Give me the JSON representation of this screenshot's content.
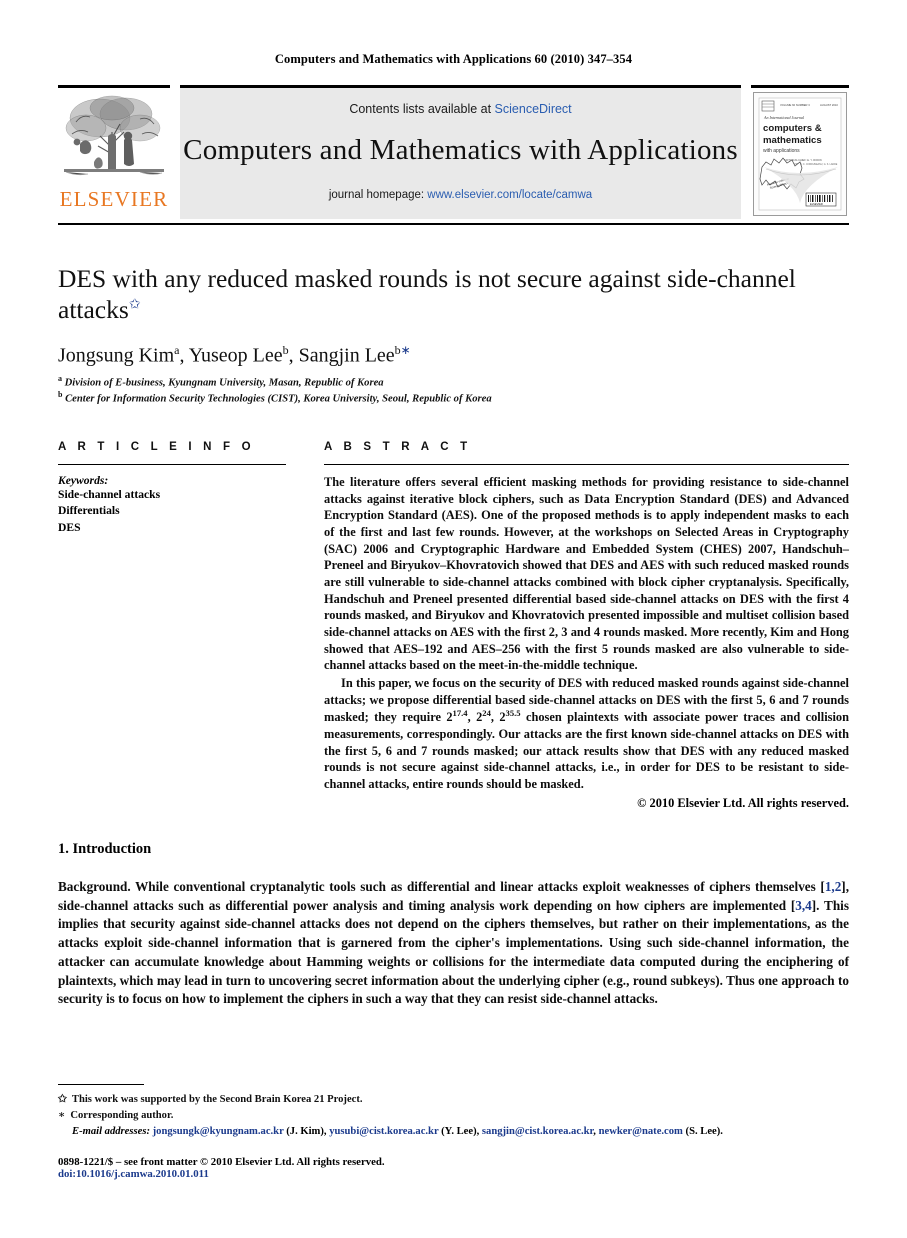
{
  "running_head": "Computers and Mathematics with Applications 60 (2010) 347–354",
  "masthead": {
    "publisher_name": "ELSEVIER",
    "contents_prefix": "Contents lists available at ",
    "contents_link": "ScienceDirect",
    "journal_title": "Computers and Mathematics with Applications",
    "homepage_prefix": "journal homepage: ",
    "homepage_url": "www.elsevier.com/locate/camwa",
    "cover": {
      "top_line": "An International Journal",
      "title_line_1": "computers &",
      "title_line_2": "mathematics",
      "title_line_3": "with applications",
      "badge_text": "Available online at ScienceDirect"
    },
    "link_color": "#2a5db0",
    "accent_color": "#E87722"
  },
  "article": {
    "title": "DES with any reduced masked rounds is not secure against side-channel attacks",
    "title_footnote_marker": "✩",
    "authors": [
      {
        "name": "Jongsung Kim",
        "affil_marker": "a"
      },
      {
        "name": "Yuseop Lee",
        "affil_marker": "b"
      },
      {
        "name": "Sangjin Lee",
        "affil_marker": "b",
        "corresponding_marker": "∗"
      }
    ],
    "affiliations": [
      {
        "marker": "a",
        "text": "Division of E-business, Kyungnam University, Masan, Republic of Korea"
      },
      {
        "marker": "b",
        "text": "Center for Information Security Technologies (CIST), Korea University, Seoul, Republic of Korea"
      }
    ]
  },
  "article_info": {
    "label": "A R T I C L E  I N F O",
    "keywords_heading": "Keywords:",
    "keywords": [
      "Side-channel attacks",
      "Differentials",
      "DES"
    ]
  },
  "abstract": {
    "label": "A B S T R A C T",
    "paragraph_1_part_1": "The literature offers several efficient masking methods for providing resistance to side-channel attacks against iterative block ciphers, such as Data Encryption Standard (DES) and Advanced Encryption Standard (AES). One of the proposed methods is to apply independent masks to each of the first and last few rounds. However, at the workshops on Selected Areas in Cryptography (SAC) 2006 and Cryptographic Hardware and Embedded System (CHES) 2007, Handschuh–Preneel and Biryukov–Khovratovich showed that DES and AES with such reduced masked rounds are still vulnerable to side-channel attacks combined with block cipher cryptanalysis. Specifically, Handschuh and Preneel presented differential based side-channel attacks on DES with the first 4 rounds masked, and Biryukov and Khovratovich presented impossible and multiset collision based side-channel attacks on AES with the first 2, 3 and 4 rounds masked. More recently, Kim and Hong showed that AES–192 and AES–256 with the first 5 rounds masked are also vulnerable to side-channel attacks based on the meet-in-the-middle technique.",
    "paragraph_2_part_1": "In this paper, we focus on the security of DES with reduced masked rounds against side-channel attacks; we propose differential based side-channel attacks on DES with the first 5, 6 and 7 rounds masked; they require 2",
    "exp_1": "17.4",
    "paragraph_2_part_2": ", 2",
    "exp_2": "24",
    "paragraph_2_part_3": ", 2",
    "exp_3": "35.5",
    "paragraph_2_part_4": " chosen plaintexts with associate power traces and collision measurements, correspondingly. Our attacks are the first known side-channel attacks on DES with the first 5, 6 and 7 rounds masked; our attack results show that DES with any reduced masked rounds is not secure against side-channel attacks, i.e., in order for DES to be resistant to side-channel attacks, entire rounds should be masked.",
    "copyright": "© 2010 Elsevier Ltd. All rights reserved."
  },
  "introduction": {
    "heading": "1. Introduction",
    "lead": "Background.",
    "text_part_1": " While conventional cryptanalytic tools such as differential and linear attacks exploit weaknesses of ciphers themselves [",
    "cite_1": "1,2",
    "text_part_2": "], side-channel attacks such as differential power analysis and timing analysis work depending on how ciphers are implemented [",
    "cite_2": "3,4",
    "text_part_3": "]. This implies that security against side-channel attacks does not depend on the ciphers themselves, but rather on their implementations, as the attacks exploit side-channel information that is garnered from the cipher's implementations. Using such side-channel information, the attacker can accumulate knowledge about Hamming weights or collisions for the intermediate data computed during the enciphering of plaintexts, which may lead in turn to uncovering secret information about the underlying cipher (e.g., round subkeys). Thus one approach to security is to focus on how to implement the ciphers in such a way that they can resist side-channel attacks."
  },
  "footnotes": {
    "note_star_marker": "✩",
    "note_star_text": "This work was supported by the Second Brain Korea 21 Project.",
    "note_corr_marker": "∗",
    "note_corr_text": "Corresponding author.",
    "emails_label": "E-mail addresses:",
    "emails": [
      {
        "address": "jongsungk@kyungnam.ac.kr",
        "owner": "(J. Kim)"
      },
      {
        "address": "yusubi@cist.korea.ac.kr",
        "owner": "(Y. Lee)"
      },
      {
        "address": "sangjin@cist.korea.ac.kr",
        "owner": ""
      },
      {
        "address": "newker@nate.com",
        "owner": "(S. Lee)"
      }
    ],
    "issn_line": "0898-1221/$ – see front matter © 2010 Elsevier Ltd. All rights reserved.",
    "doi_line": "doi:10.1016/j.camwa.2010.01.011"
  }
}
